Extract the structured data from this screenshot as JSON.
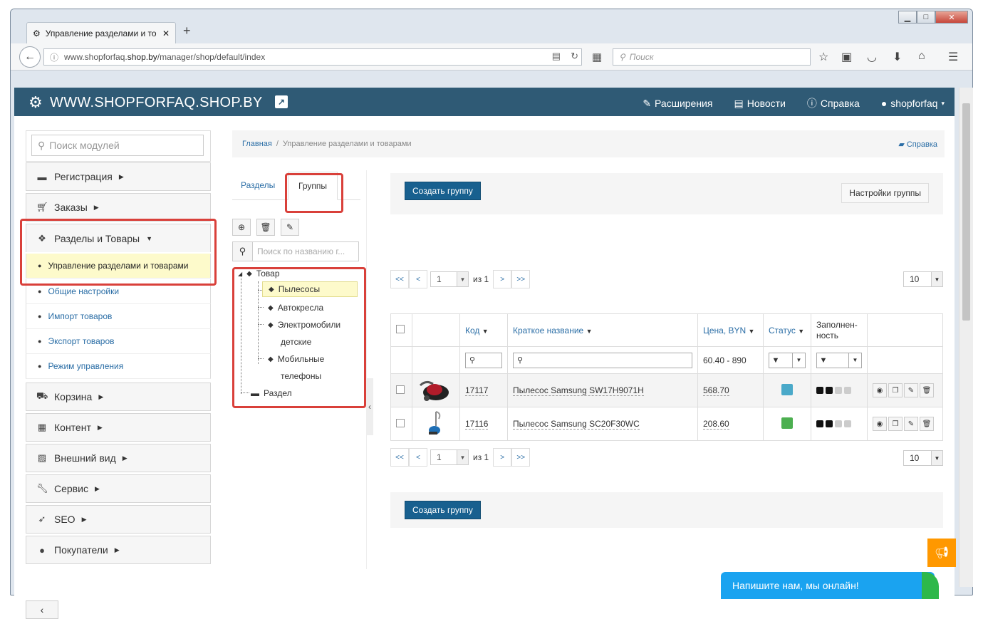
{
  "browser": {
    "tab_title": "Управление разделами и то",
    "url_prefix": "www.shopforfaq.",
    "url_host": "shop.by",
    "url_path": "/manager/shop/default/index",
    "search_placeholder": "Поиск"
  },
  "header": {
    "site_name": "WWW.SHOPFORFAQ.SHOP.BY",
    "nav": [
      "Расширения",
      "Новости",
      "Справка",
      "shopforfaq"
    ]
  },
  "sidebar": {
    "search_placeholder": "Поиск модулей",
    "top_items": [
      "Регистрация",
      "Заказы",
      "Разделы и Товары"
    ],
    "sub_items": [
      "Управление разделами и товарами",
      "Общие настройки",
      "Импорт товаров",
      "Экспорт товаров",
      "Режим управления"
    ],
    "bottom_items": [
      "Корзина",
      "Контент",
      "Внешний вид",
      "Сервис",
      "SEO",
      "Покупатели"
    ]
  },
  "breadcrumb": {
    "home": "Главная",
    "sep": "/",
    "current": "Управление разделами и товарами",
    "help": "Справка"
  },
  "tree": {
    "tabs": [
      "Разделы",
      "Группы"
    ],
    "search_placeholder": "Поиск по названию г...",
    "root": "Товар",
    "children": [
      "Пылесосы",
      "Автокресла",
      "Электромобили",
      "детские",
      "Мобильные",
      "телефоны"
    ],
    "section": "Раздел"
  },
  "content": {
    "create_button": "Создать группу",
    "settings_button": "Настройки группы",
    "pager": {
      "first": "<<",
      "prev": "<",
      "page": "1",
      "of": "из 1",
      "next": ">",
      "last": ">>",
      "per_page": "10"
    },
    "columns": [
      "Код",
      "Краткое название",
      "Цена, BYN",
      "Статус",
      "Заполнен-",
      "ность"
    ],
    "price_filter": "60.40 - 890",
    "rows": [
      {
        "code": "17117",
        "name": "Пылесос Samsung SW17H9071H",
        "price": "568.70",
        "status_color": "#4aa9c9"
      },
      {
        "code": "17116",
        "name": "Пылесос Samsung SC20F30WC",
        "price": "208.60",
        "status_color": "#4caf50"
      }
    ]
  },
  "chat": {
    "label": "Напишите нам, мы онлайн!"
  }
}
